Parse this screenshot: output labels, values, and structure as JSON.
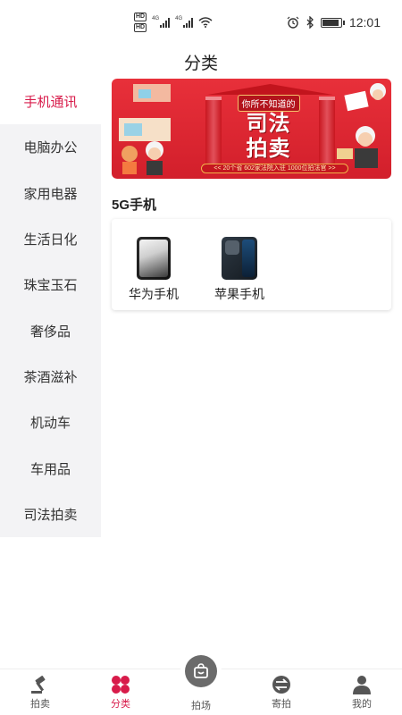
{
  "status_bar": {
    "hd1": "HD",
    "hd2": "HD",
    "net1": "4G",
    "net2": "4G",
    "time": "12:01",
    "battery_level": 0.8
  },
  "header": {
    "title": "分类"
  },
  "sidebar": {
    "active_index": 0,
    "items": [
      {
        "label": "手机通讯"
      },
      {
        "label": "电脑办公"
      },
      {
        "label": "家用电器"
      },
      {
        "label": "生活日化"
      },
      {
        "label": "珠宝玉石"
      },
      {
        "label": "奢侈品"
      },
      {
        "label": "茶酒滋补"
      },
      {
        "label": "机动车"
      },
      {
        "label": "车用品"
      },
      {
        "label": "司法拍卖"
      }
    ]
  },
  "banner": {
    "subtitle": "你所不知道的",
    "title_line1": "司法",
    "title_line2": "拍卖",
    "strip": "<< 20个省  602家法院入驻  1000位拍法官 >>"
  },
  "section": {
    "title": "5G手机",
    "products": [
      {
        "label": "华为手机"
      },
      {
        "label": "苹果手机"
      }
    ]
  },
  "bottom_nav": {
    "active_index": 1,
    "items": [
      {
        "label": "拍卖",
        "icon": "gavel-icon"
      },
      {
        "label": "分类",
        "icon": "clover-icon"
      },
      {
        "label": "拍场",
        "icon": "bag-icon"
      },
      {
        "label": "寄拍",
        "icon": "exchange-icon"
      },
      {
        "label": "我的",
        "icon": "user-icon"
      }
    ]
  },
  "colors": {
    "accent": "#d81b4a",
    "sidebar_bg": "#f3f3f5",
    "banner_red": "#d21f2b"
  }
}
